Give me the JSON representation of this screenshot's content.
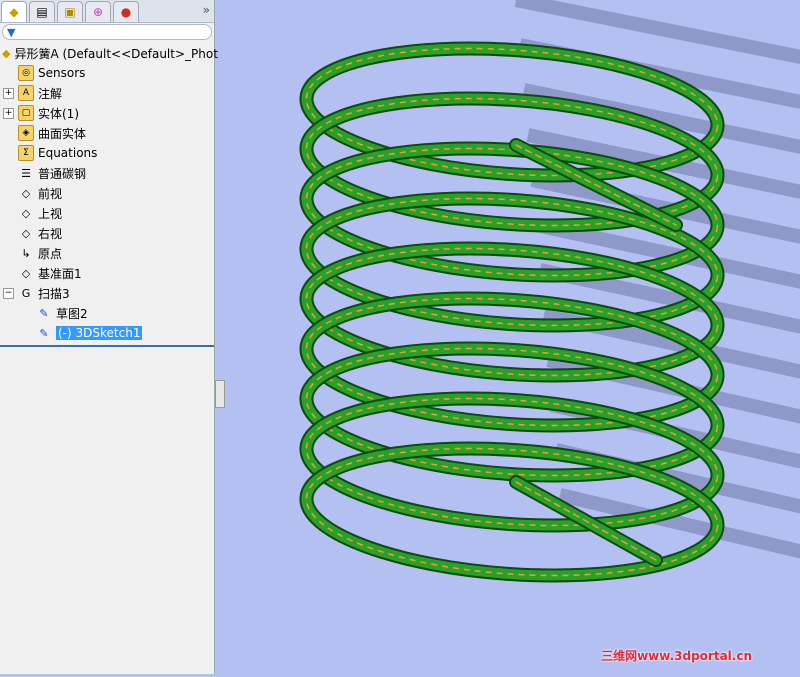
{
  "tabs": [
    {
      "name": "feature-manager",
      "icon": "part-icon"
    },
    {
      "name": "property-manager",
      "icon": "property-icon"
    },
    {
      "name": "configuration-manager",
      "icon": "config-icon"
    },
    {
      "name": "dimxpert",
      "icon": "target-icon"
    },
    {
      "name": "display-manager",
      "icon": "appearance-icon"
    }
  ],
  "more": "»",
  "filter_icon": "filter-icon",
  "tree": {
    "root": "异形簧A  (Default<<Default>_Phot",
    "items": [
      {
        "label": "Sensors",
        "icon": "sensor-icon",
        "expand": ""
      },
      {
        "label": "注解",
        "icon": "annotation-icon",
        "expand": "+"
      },
      {
        "label": "实体(1)",
        "icon": "solid-bodies-icon",
        "expand": "+"
      },
      {
        "label": "曲面实体",
        "icon": "surface-bodies-icon",
        "expand": ""
      },
      {
        "label": "Equations",
        "icon": "equations-icon",
        "expand": ""
      },
      {
        "label": "普通碳钢",
        "icon": "material-icon",
        "expand": ""
      },
      {
        "label": "前视",
        "icon": "plane-icon",
        "expand": ""
      },
      {
        "label": "上视",
        "icon": "plane-icon",
        "expand": ""
      },
      {
        "label": "右视",
        "icon": "plane-icon",
        "expand": ""
      },
      {
        "label": "原点",
        "icon": "origin-icon",
        "expand": ""
      },
      {
        "label": "基准面1",
        "icon": "plane-icon",
        "expand": ""
      },
      {
        "label": "扫描3",
        "icon": "sweep-icon",
        "expand": "−"
      }
    ],
    "children": [
      {
        "label": "草图2",
        "icon": "sketch-icon"
      },
      {
        "label": "(-) 3DSketch1",
        "icon": "3dsketch-icon",
        "selected": true
      }
    ]
  },
  "watermark": "三维网www.3dportal.cn",
  "colors": {
    "spring": "#2aa02a",
    "path": "#e8a030",
    "background": "#b4c0f2"
  }
}
